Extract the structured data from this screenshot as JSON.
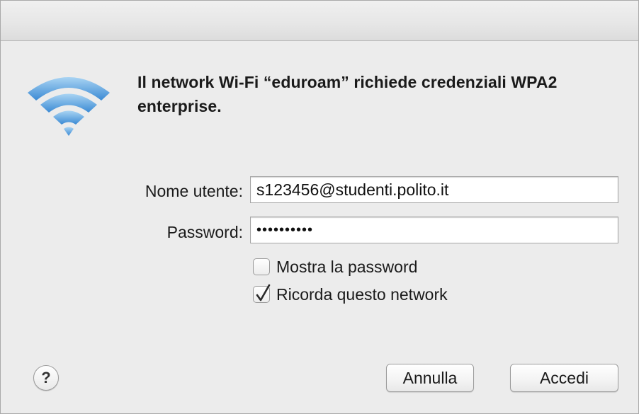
{
  "dialog": {
    "message": "Il network Wi-Fi “eduroam” richiede credenziali WPA2 enterprise.",
    "icon": "wifi-icon"
  },
  "form": {
    "username_label": "Nome utente:",
    "username_value": "s123456@studenti.polito.it",
    "password_label": "Password:",
    "password_value": "••••••••••",
    "show_password_label": "Mostra la password",
    "show_password_checked": false,
    "remember_network_label": "Ricorda questo network",
    "remember_network_checked": true
  },
  "buttons": {
    "help_label": "?",
    "cancel_label": "Annulla",
    "connect_label": "Accedi"
  },
  "colors": {
    "wifi_light": "#8ec5ee",
    "wifi_dark": "#3a8ad6",
    "window_bg": "#ececec"
  }
}
